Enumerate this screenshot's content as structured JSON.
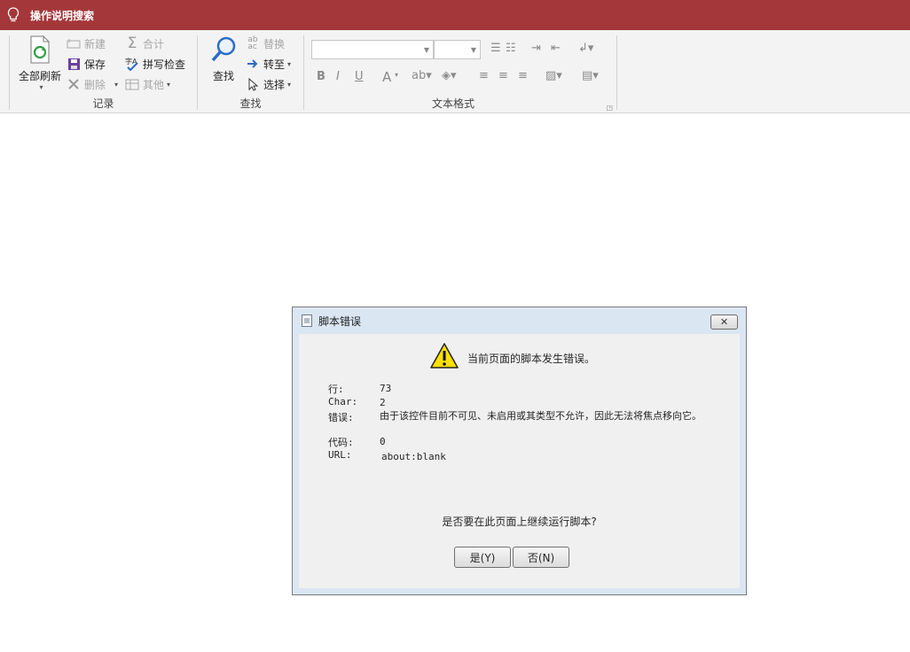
{
  "titlebar": {
    "title": "操作说明搜索"
  },
  "ribbon": {
    "records": {
      "label": "记录",
      "refresh_all": "全部刷新",
      "new": "新建",
      "save": "保存",
      "delete": "删除",
      "totals": "合计",
      "spelling": "拼写检查",
      "more": "其他"
    },
    "find": {
      "label": "查找",
      "find": "查找",
      "replace": "替换",
      "goto": "转至",
      "select": "选择"
    },
    "text_format": {
      "label": "文本格式",
      "bold": "B",
      "italic": "I",
      "underline": "U",
      "font_color": "A"
    }
  },
  "dialog": {
    "title": "脚本错误",
    "message": "当前页面的脚本发生错误。",
    "fields": [
      {
        "label": "行:",
        "value": "73"
      },
      {
        "label": "Char:",
        "value": "2"
      },
      {
        "label": "错误:",
        "value": "由于该控件目前不可见、未启用或其类型不允许，因此无法将焦点移向它。"
      },
      {
        "label": "代码:",
        "value": "0"
      },
      {
        "label": "URL:",
        "value": "about:blank"
      }
    ],
    "question": "是否要在此页面上继续运行脚本?",
    "yes_button": "是(Y)",
    "no_button": "否(N)"
  },
  "colors": {
    "titlebar": "#a4373a",
    "ribbon": "#f3f3f3",
    "dialog_frame": "#dbe6f3"
  }
}
